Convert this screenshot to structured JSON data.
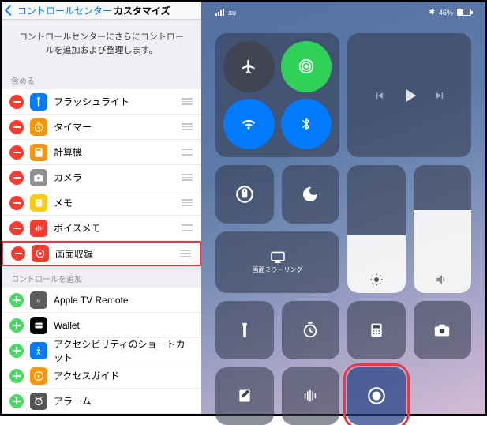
{
  "nav": {
    "back": "コントロールセンター",
    "title": "カスタマイズ"
  },
  "description": "コントロールセンターにさらにコントロールを追加および整理します。",
  "include_header": "含める",
  "add_header": "コントロールを追加",
  "included": [
    {
      "label": "フラッシュライト",
      "icon": "flashlight",
      "color": "#007aff"
    },
    {
      "label": "タイマー",
      "icon": "timer",
      "color": "#ff9500"
    },
    {
      "label": "計算機",
      "icon": "calculator",
      "color": "#ff9500"
    },
    {
      "label": "カメラ",
      "icon": "camera",
      "color": "#8e8e93"
    },
    {
      "label": "メモ",
      "icon": "notes",
      "color": "#ffcc00"
    },
    {
      "label": "ボイスメモ",
      "icon": "voice",
      "color": "#ff3b30"
    },
    {
      "label": "画面収録",
      "icon": "record",
      "color": "#ff3b30",
      "highlight": true
    }
  ],
  "available": [
    {
      "label": "Apple TV Remote",
      "icon": "appletv",
      "color": "#5c5c5c"
    },
    {
      "label": "Wallet",
      "icon": "wallet",
      "color": "#000"
    },
    {
      "label": "アクセシビリティのショートカット",
      "icon": "accessibility",
      "color": "#007aff"
    },
    {
      "label": "アクセスガイド",
      "icon": "guide",
      "color": "#ff9500"
    },
    {
      "label": "アラーム",
      "icon": "alarm",
      "color": "#555"
    }
  ],
  "status": {
    "carrier": "au",
    "battery_text": "45%",
    "bt": "✱"
  },
  "mirror_label": "画面ミラーリング",
  "brightness_pct": 45,
  "volume_pct": 65
}
